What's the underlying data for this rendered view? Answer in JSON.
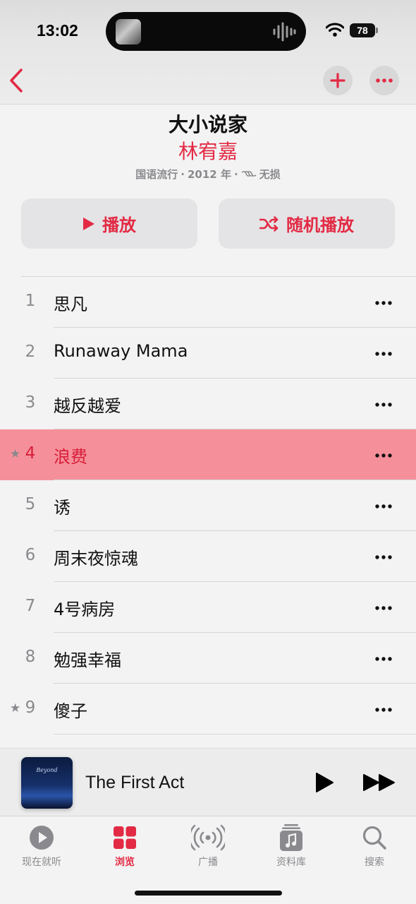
{
  "status_bar": {
    "time": "13:02",
    "battery": "78"
  },
  "nav": {
    "back_icon": "chevron-left-icon",
    "add_icon": "plus-icon",
    "more_icon": "ellipsis-icon"
  },
  "album": {
    "title": "大小说家",
    "artist": "林宥嘉",
    "genre": "国语流行",
    "year": "2012 年",
    "quality": "无损",
    "separator": "·"
  },
  "actions": {
    "play_label": "播放",
    "shuffle_label": "随机播放"
  },
  "tracks": [
    {
      "number": "1",
      "title": "思凡",
      "starred": false,
      "playing": false
    },
    {
      "number": "2",
      "title": "Runaway Mama",
      "starred": false,
      "playing": false
    },
    {
      "number": "3",
      "title": "越反越爱",
      "starred": false,
      "playing": false
    },
    {
      "number": "4",
      "title": "浪费",
      "starred": true,
      "playing": true
    },
    {
      "number": "5",
      "title": "诱",
      "starred": false,
      "playing": false
    },
    {
      "number": "6",
      "title": "周末夜惊魂",
      "starred": false,
      "playing": false
    },
    {
      "number": "7",
      "title": "4号病房",
      "starred": false,
      "playing": false
    },
    {
      "number": "8",
      "title": "勉强幸福",
      "starred": false,
      "playing": false
    },
    {
      "number": "9",
      "title": "傻子",
      "starred": true,
      "playing": false
    }
  ],
  "star_glyph": "★",
  "now_playing": {
    "title": "The First Act",
    "art_text": "Beyond"
  },
  "tabs": [
    {
      "label": "现在就听",
      "icon": "play-circle-icon",
      "active": false
    },
    {
      "label": "浏览",
      "icon": "grid-icon",
      "active": true
    },
    {
      "label": "广播",
      "icon": "broadcast-icon",
      "active": false
    },
    {
      "label": "资料库",
      "icon": "library-icon",
      "active": false
    },
    {
      "label": "搜索",
      "icon": "search-icon",
      "active": false
    }
  ],
  "colors": {
    "accent": "#e32a44",
    "playing_row": "#f5909a",
    "secondary_text": "#8a8a8e"
  }
}
